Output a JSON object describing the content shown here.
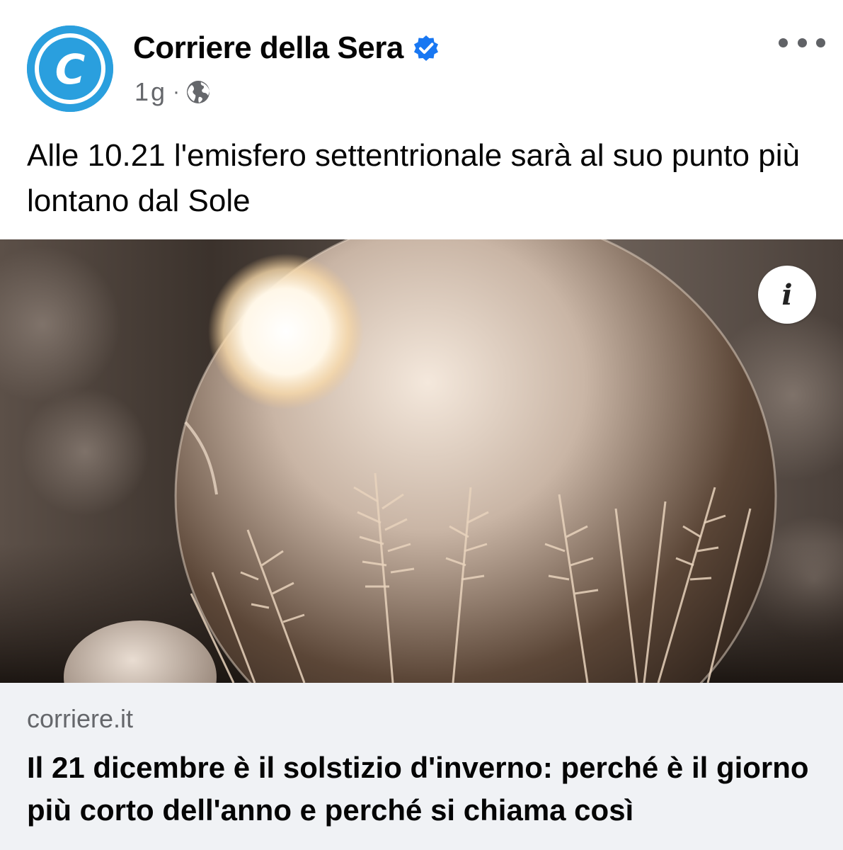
{
  "post": {
    "author": "Corriere della Sera",
    "avatar_letter": "C",
    "verified": true,
    "timestamp": "1g",
    "separator": "·",
    "audience_icon": "globe-icon",
    "menu_icon": "more-options-icon",
    "caption": "Alle 10.21 l'emisfero settentrionale sarà al suo punto più lontano dal Sole"
  },
  "link_preview": {
    "domain": "corriere.it",
    "headline": "Il 21 dicembre è il solstizio d'inverno: perché è il giorno più corto dell'anno e perché si chiama così",
    "info_icon": "info-icon"
  },
  "colors": {
    "brand_blue": "#2a9fde",
    "verified_blue": "#1877f2",
    "text": "#050505",
    "secondary_text": "#65676b",
    "preview_background": "#f0f2f5"
  }
}
